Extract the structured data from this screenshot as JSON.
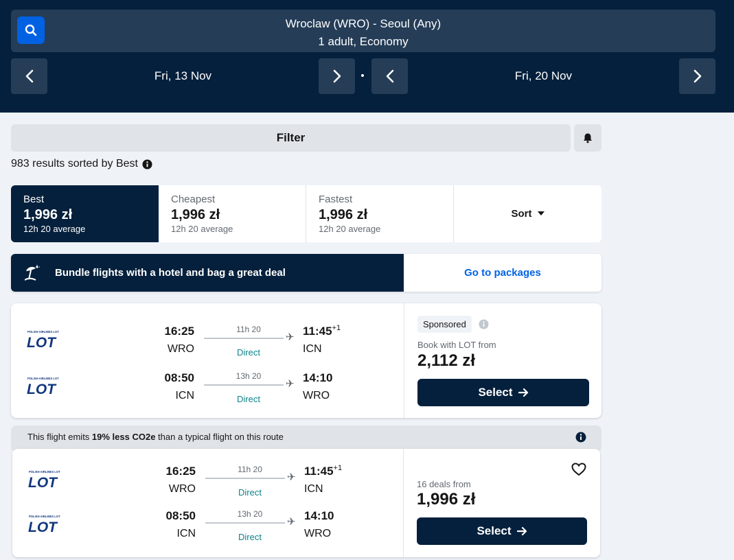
{
  "header": {
    "route": "Wroclaw (WRO) - Seoul (Any)",
    "passengers": "1 adult, Economy",
    "depart_date": "Fri, 13 Nov",
    "return_date": "Fri, 20 Nov"
  },
  "filter": {
    "label": "Filter",
    "results_summary": "983 results sorted by Best"
  },
  "tabs": [
    {
      "title": "Best",
      "price": "1,996 zł",
      "sub": "12h 20 average"
    },
    {
      "title": "Cheapest",
      "price": "1,996 zł",
      "sub": "12h 20 average"
    },
    {
      "title": "Fastest",
      "price": "1,996 zł",
      "sub": "12h 20 average"
    }
  ],
  "sort_label": "Sort",
  "bundle": {
    "text": "Bundle flights with a hotel and bag a great deal",
    "cta": "Go to packages"
  },
  "results": [
    {
      "outbound": {
        "dep_time": "16:25",
        "dep_code": "WRO",
        "duration": "11h 20",
        "stops": "Direct",
        "arr_time": "11:45",
        "arr_offset": "+1",
        "arr_code": "ICN"
      },
      "inbound": {
        "dep_time": "08:50",
        "dep_code": "ICN",
        "duration": "13h 20",
        "stops": "Direct",
        "arr_time": "14:10",
        "arr_code": "WRO"
      },
      "badge": "Sponsored",
      "from_label": "Book with LOT from",
      "price": "2,112 zł",
      "select": "Select"
    },
    {
      "outbound": {
        "dep_time": "16:25",
        "dep_code": "WRO",
        "duration": "11h 20",
        "stops": "Direct",
        "arr_time": "11:45",
        "arr_offset": "+1",
        "arr_code": "ICN"
      },
      "inbound": {
        "dep_time": "08:50",
        "dep_code": "ICN",
        "duration": "13h 20",
        "stops": "Direct",
        "arr_time": "14:10",
        "arr_code": "WRO"
      },
      "from_label": "16 deals from",
      "price": "1,996 zł",
      "select": "Select"
    }
  ],
  "eco": {
    "prefix": "This flight emits ",
    "highlight": "19% less CO2e",
    "suffix": " than a typical flight on this route"
  },
  "airline_logo": "POLISH AIRLINES LOT",
  "colors": {
    "header_bg": "#05203c",
    "accent_blue": "#0062e3",
    "direct_teal": "#0c838a"
  }
}
